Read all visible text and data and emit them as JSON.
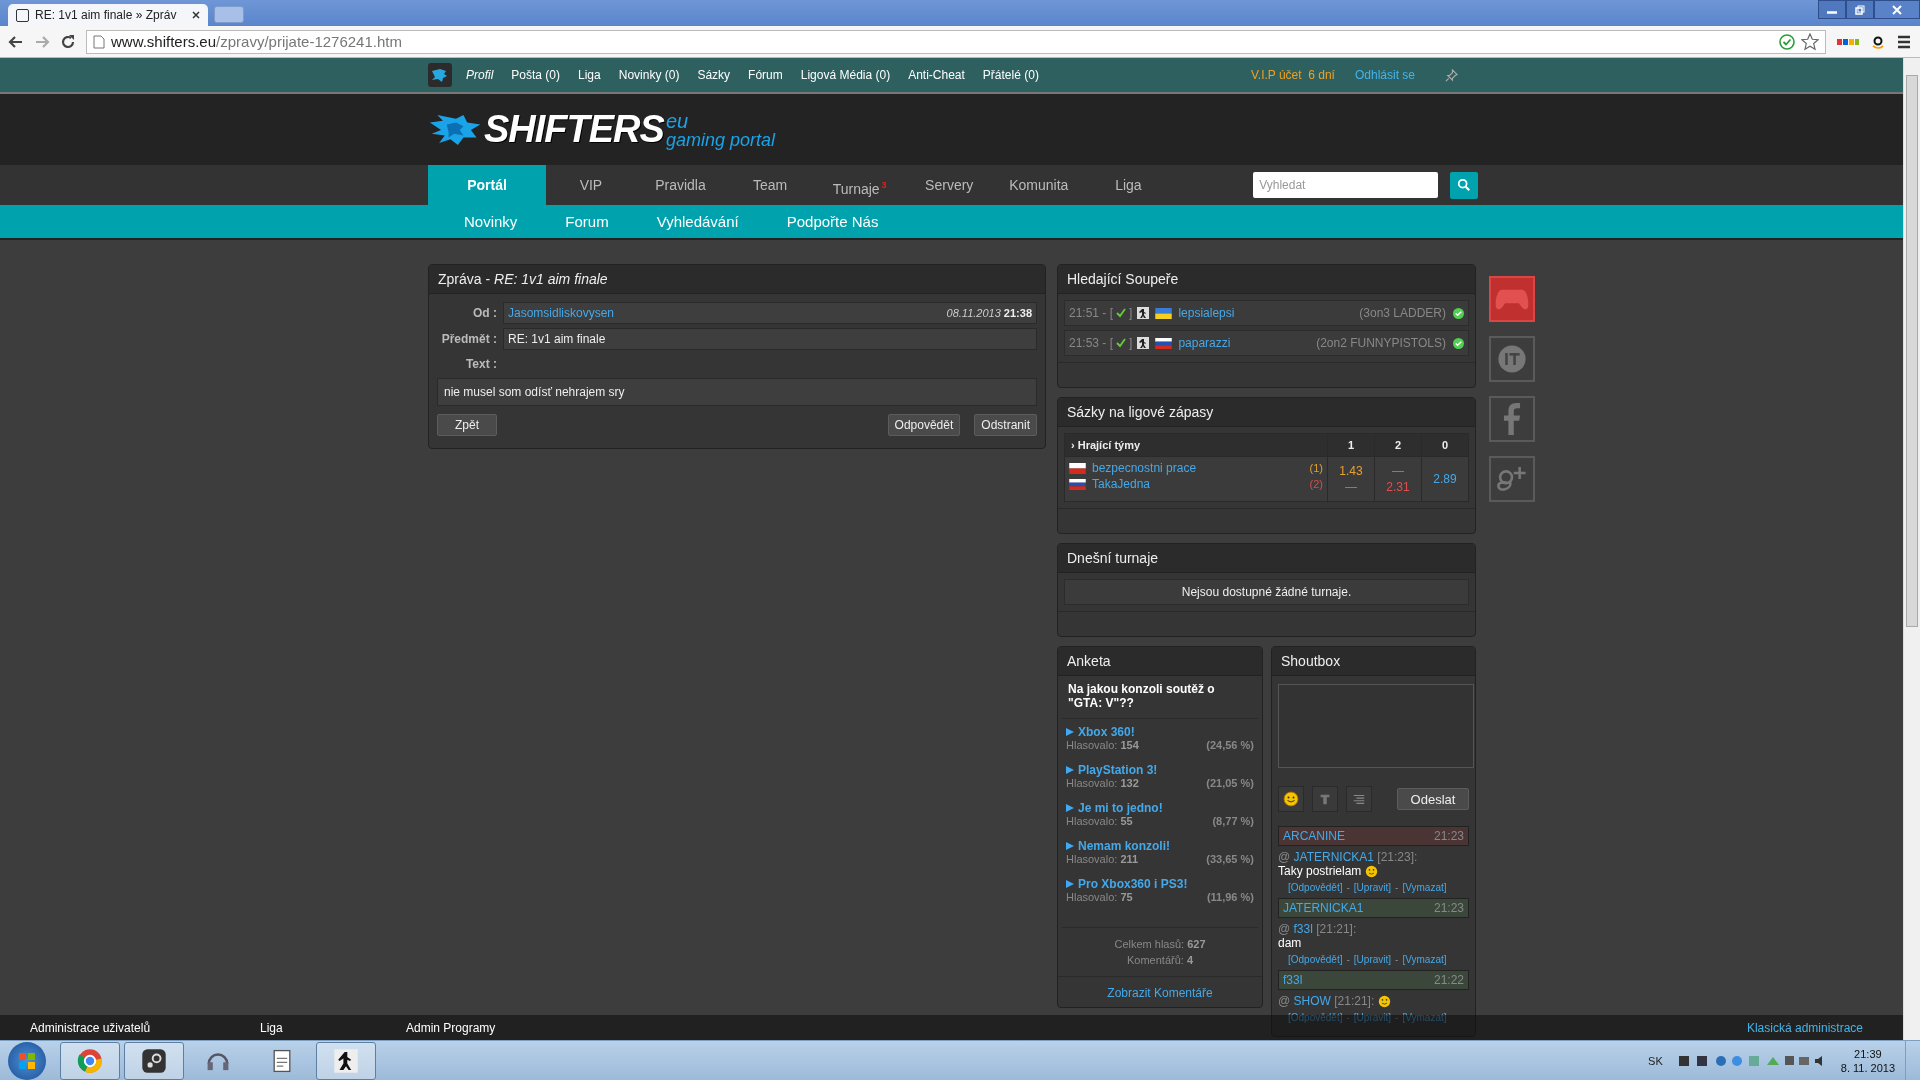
{
  "browser": {
    "tab_title": "RE: 1v1 aim finale » Zpráv",
    "url_host": "www.shifters.eu",
    "url_path": "/zpravy/prijate-1276241.htm"
  },
  "site_topbar": {
    "items": [
      {
        "label": "Profil",
        "italic": true
      },
      {
        "label": "Pošta (0)",
        "italic": false
      },
      {
        "label": "Liga",
        "italic": false
      },
      {
        "label": "Novinky (0)",
        "italic": false
      },
      {
        "label": "Sázky",
        "italic": false
      },
      {
        "label": "Fórum",
        "italic": false
      },
      {
        "label": "Ligová Média (0)",
        "italic": false
      },
      {
        "label": "Anti-Cheat",
        "italic": false
      },
      {
        "label": "Přátelé (0)",
        "italic": false
      }
    ],
    "vip": "V.I.P účet  6 dní",
    "logout": "Odhlásit se"
  },
  "logo": {
    "name": "SHIFTERS",
    "suffix": "eu",
    "tagline": "gaming portal"
  },
  "main_nav": [
    {
      "label": "Portál",
      "selected": true
    },
    {
      "label": "VIP",
      "selected": false
    },
    {
      "label": "Pravidla",
      "selected": false
    },
    {
      "label": "Team",
      "selected": false
    },
    {
      "label": "Turnaje",
      "selected": false,
      "badge": "3"
    },
    {
      "label": "Servery",
      "selected": false
    },
    {
      "label": "Komunita",
      "selected": false
    },
    {
      "label": "Liga",
      "selected": false
    }
  ],
  "search": {
    "placeholder": "Vyhledat"
  },
  "sub_nav": [
    "Novinky",
    "Forum",
    "Vyhledávání",
    "Podpořte Nás"
  ],
  "message": {
    "title": "Zpráva -",
    "subject_title": "RE: 1v1 aim finale",
    "from_label": "Od :",
    "from": "Jasomsidliskovysen",
    "date": "08.11.2013",
    "time": "21:38",
    "subject_label": "Předmět :",
    "subject": "RE: 1v1 aim finale",
    "text_label": "Text :",
    "text": "nie musel som odísť nehrajem sry",
    "buttons": {
      "back": "Zpět",
      "reply": "Odpovědět",
      "delete": "Odstranit"
    }
  },
  "opponents": {
    "title": "Hledající Soupeře",
    "rows": [
      {
        "time": "21:51 - [",
        "close": "]",
        "kind": "flag_ua",
        "name": "lepsialepsi",
        "mode": "(3on3 LADDER)"
      },
      {
        "time": "21:53 - [",
        "close": "]",
        "kind": "flag_sk",
        "name": "paparazzi",
        "mode": "(2on2 FUNNYPISTOLS)"
      }
    ]
  },
  "bets": {
    "title": "Sázky na ligové zápasy",
    "columns": [
      "› Hrající týmy",
      "1",
      "2",
      "0"
    ],
    "teams": [
      {
        "kind": "flag_cz",
        "name": "bezpecnostni prace",
        "seed": "(1)"
      },
      {
        "kind": "flag_sk",
        "name": "TakaJedna",
        "seed": "(2)"
      }
    ],
    "odds_1": [
      "1.43",
      "—"
    ],
    "odds_2": [
      "—",
      "2.31"
    ],
    "odds_0": "2.89"
  },
  "tournaments": {
    "title": "Dnešní turnaje",
    "empty": "Nejsou dostupné žádné turnaje."
  },
  "poll": {
    "title": "Anketa",
    "question": "Na jakou konzoli soutěž o \"GTA: V\"??",
    "options": [
      {
        "label": "Xbox 360!",
        "votes_label": "Hlasovalo:",
        "votes": "154",
        "percent": "(24,56 %)"
      },
      {
        "label": "PlayStation 3!",
        "votes_label": "Hlasovalo:",
        "votes": "132",
        "percent": "(21,05 %)"
      },
      {
        "label": "Je mi to jedno!",
        "votes_label": "Hlasovalo:",
        "votes": "55",
        "percent": "(8,77 %)"
      },
      {
        "label": "Nemam konzoli!",
        "votes_label": "Hlasovalo:",
        "votes": "211",
        "percent": "(33,65 %)"
      },
      {
        "label": "Pro Xbox360 i PS3!",
        "votes_label": "Hlasovalo:",
        "votes": "75",
        "percent": "(11,96 %)"
      }
    ],
    "total_label": "Celkem hlasů:",
    "total": "627",
    "comments_label": "Komentářů:",
    "comments": "4",
    "link": "Zobrazit Komentáře"
  },
  "shoutbox": {
    "title": "Shoutbox",
    "send": "Odeslat",
    "messages": [
      {
        "author": "ARCANINE",
        "time": "21:23",
        "color": "#4a3434",
        "at": "@",
        "reply_to": "JATERNICKA1",
        "reply_time": "[21:23]:",
        "text": "Taky postrielam",
        "emoticon": true,
        "actions": [
          "[Odpovědět]",
          "-",
          "[Upravit]",
          "-",
          "[Vymazat]"
        ]
      },
      {
        "author": "JATERNICKA1",
        "time": "21:23",
        "color": "#3c473b",
        "at": "@",
        "reply_to": "f33l",
        "reply_time": "[21:21]:",
        "text": "dam",
        "emoticon": false,
        "actions": [
          "[Odpovědět]",
          "-",
          "[Upravit]",
          "-",
          "[Vymazat]"
        ]
      },
      {
        "author": "f33l",
        "time": "21:22",
        "color": "#3c473b",
        "at": "@",
        "reply_to": "SHOW",
        "reply_time": "[21:21]:",
        "emoticon": true,
        "actions": [
          "[Odpovědět]",
          "-",
          "[Upravit]",
          "-",
          "[Vymazat]"
        ]
      }
    ]
  },
  "admin_bar": {
    "items": [
      "Administrace uživatelů",
      "Liga",
      "Admin Programy"
    ],
    "right": "Klasická administrace"
  },
  "taskbar": {
    "language": "SK",
    "time": "21:39",
    "date": "8. 11. 2013"
  }
}
